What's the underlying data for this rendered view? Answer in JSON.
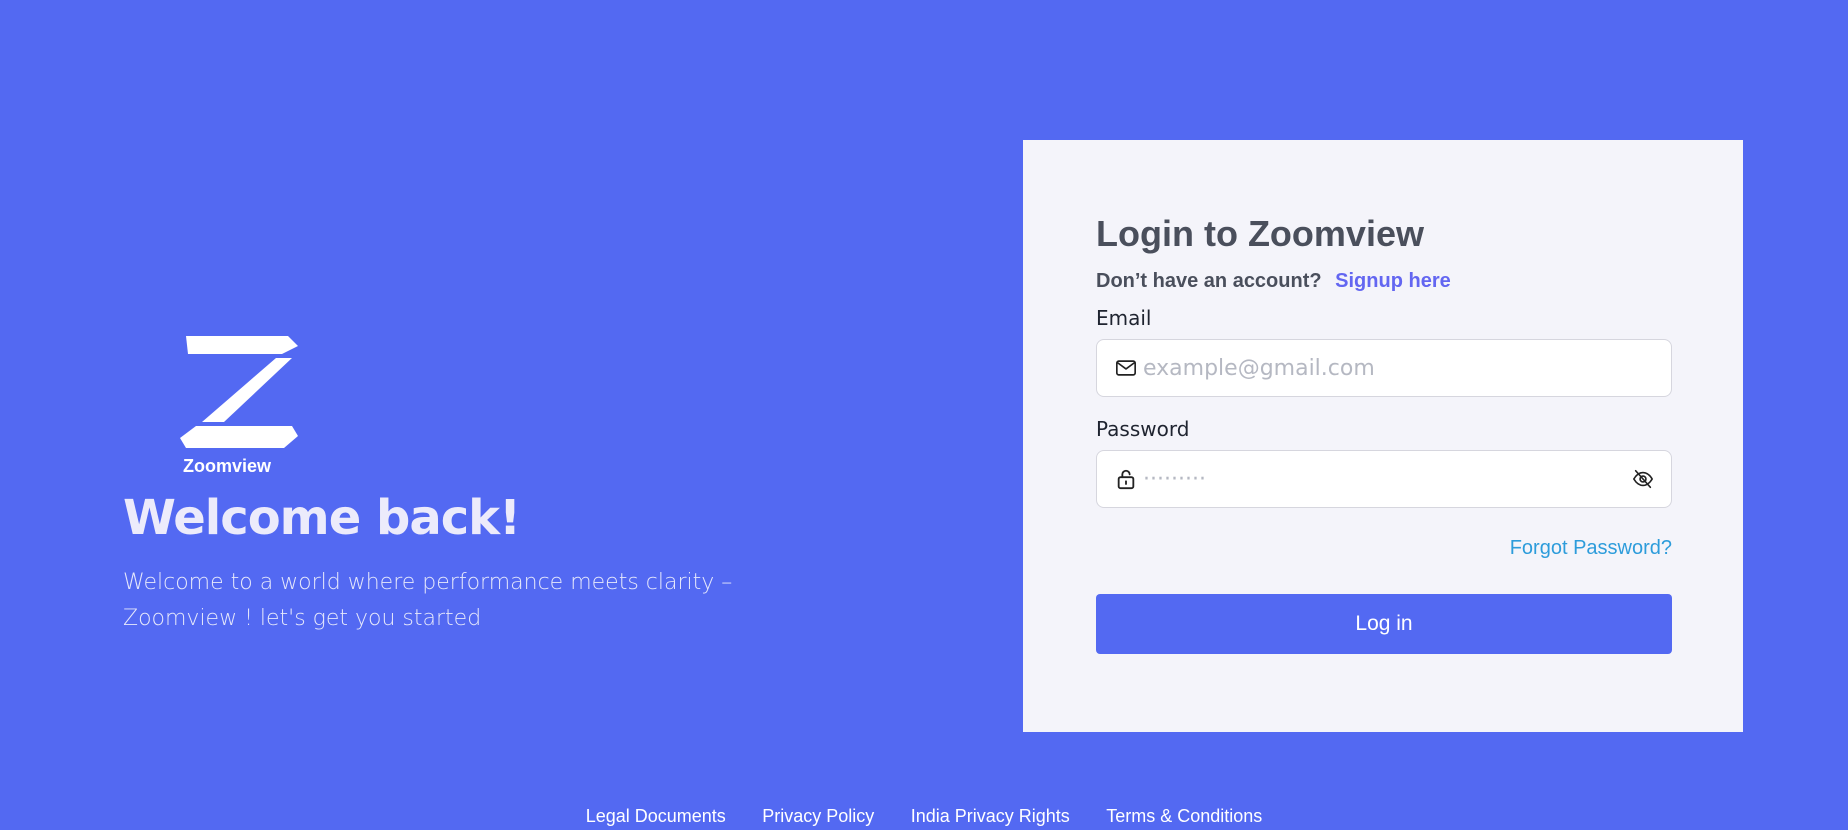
{
  "brand": {
    "name": "Zoomview",
    "logo_icon": "z-logo-icon"
  },
  "hero": {
    "title": "Welcome back!",
    "subtitle": "Welcome to a world where performance meets clarity – Zoomview ! let's get you started"
  },
  "login": {
    "title": "Login to Zoomview",
    "signup_prompt": "Don’t have an account?",
    "signup_link": "Signup here",
    "email_label": "Email",
    "email_placeholder": "example@gmail.com",
    "email_value": "",
    "email_icon": "mail-icon",
    "password_label": "Password",
    "password_placeholder": "·········",
    "password_value": "",
    "password_icon": "lock-icon",
    "password_toggle_icon": "eye-off-icon",
    "forgot_label": "Forgot Password?",
    "submit_label": "Log in"
  },
  "footer": {
    "links": [
      "Legal Documents",
      "Privacy Policy",
      "India Privacy Rights",
      "Terms & Conditions"
    ]
  },
  "colors": {
    "background": "#5369F2",
    "card": "#F4F4FA",
    "link": "#6366F1",
    "forgot": "#2D9CDB",
    "button": "#5369F2"
  }
}
